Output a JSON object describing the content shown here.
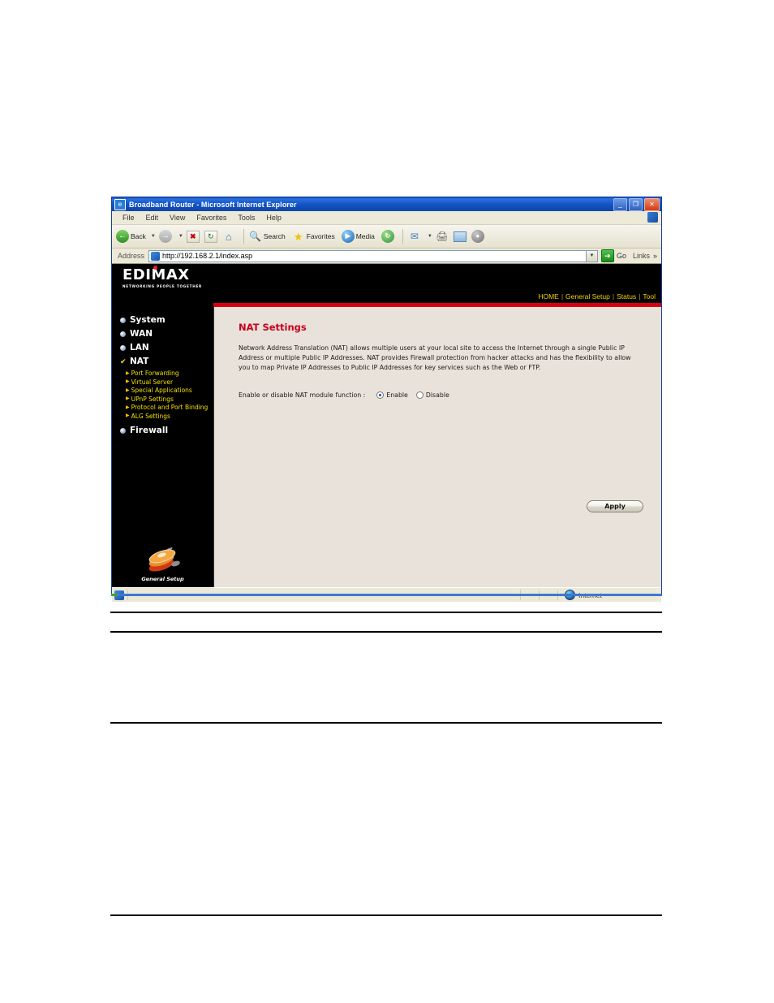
{
  "browser": {
    "window_title": "Broadband Router - Microsoft Internet Explorer",
    "window_icon": "ie-document-icon",
    "controls": {
      "minimize": "_",
      "restore": "❐",
      "close": "✕"
    },
    "menu": [
      {
        "label": "File",
        "accel": "F"
      },
      {
        "label": "Edit",
        "accel": "E"
      },
      {
        "label": "View",
        "accel": "V"
      },
      {
        "label": "Favorites",
        "accel": "a"
      },
      {
        "label": "Tools",
        "accel": "T"
      },
      {
        "label": "Help",
        "accel": "H"
      }
    ],
    "toolbar": [
      {
        "name": "back-button",
        "label": "Back",
        "icon": "back-arrow-icon"
      },
      {
        "name": "forward-button",
        "label": "",
        "icon": "forward-arrow-icon"
      },
      {
        "name": "stop-button",
        "label": "",
        "icon": "stop-icon"
      },
      {
        "name": "refresh-button",
        "label": "",
        "icon": "refresh-icon"
      },
      {
        "name": "home-button",
        "label": "",
        "icon": "home-icon"
      },
      {
        "name": "search-button",
        "label": "Search",
        "icon": "search-icon"
      },
      {
        "name": "favorites-button",
        "label": "Favorites",
        "icon": "star-icon"
      },
      {
        "name": "media-button",
        "label": "Media",
        "icon": "media-icon"
      },
      {
        "name": "history-button",
        "label": "",
        "icon": "history-icon"
      },
      {
        "name": "mail-button",
        "label": "",
        "icon": "mail-icon"
      },
      {
        "name": "print-button",
        "label": "",
        "icon": "printer-icon"
      },
      {
        "name": "edit-button",
        "label": "",
        "icon": "edit-page-icon"
      },
      {
        "name": "discuss-button",
        "label": "",
        "icon": "discuss-icon"
      }
    ],
    "address": {
      "label": "Address",
      "value": "http://192.168.2.1/index.asp",
      "placeholder": "http://",
      "go_label": "Go",
      "links_label": "Links",
      "links_chevron": "»"
    },
    "status": {
      "zone": "Internet"
    }
  },
  "router": {
    "brand": {
      "name": "EDIMAX",
      "tagline": "NETWORKING PEOPLE TOGETHER"
    },
    "nav": [
      {
        "label": "HOME"
      },
      {
        "label": "General Setup"
      },
      {
        "label": "Status"
      },
      {
        "label": "Tool"
      }
    ],
    "nav_separator": "|",
    "sidebar": {
      "items": [
        {
          "label": "System",
          "marker": "bullet"
        },
        {
          "label": "WAN",
          "marker": "bullet"
        },
        {
          "label": "LAN",
          "marker": "bullet"
        },
        {
          "label": "NAT",
          "marker": "check"
        }
      ],
      "sub_items": [
        {
          "label": "Port Forwarding"
        },
        {
          "label": "Virtual Server"
        },
        {
          "label": "Special Applications"
        },
        {
          "label": "UPnP Settings"
        },
        {
          "label": "Protocol and Port Binding"
        },
        {
          "label": "ALG Settings"
        }
      ],
      "last_item": {
        "label": "Firewall",
        "marker": "bullet"
      },
      "footer_logo_caption": "General Setup"
    },
    "page": {
      "title": "NAT Settings",
      "description": "Network Address Translation (NAT) allows multiple users at your local site to access the Internet through a single Public IP Address or multiple Public IP Addresses. NAT provides Firewall protection from hacker attacks and has the flexibility to allow you to map Private IP Addresses to Public IP Addresses for key services such as the Web or FTP.",
      "field": {
        "label": "Enable or disable NAT module function :",
        "options": [
          {
            "label": "Enable",
            "selected": true
          },
          {
            "label": "Disable",
            "selected": false
          }
        ]
      },
      "apply_label": "Apply"
    },
    "colors": {
      "accent_red": "#d8000f",
      "title_red": "#c8001e",
      "nav_yellow": "#f2d200",
      "submenu_yellow": "#f2e000",
      "panel_bg": "#e8e2da",
      "sidebar_bg": "#000000"
    }
  }
}
